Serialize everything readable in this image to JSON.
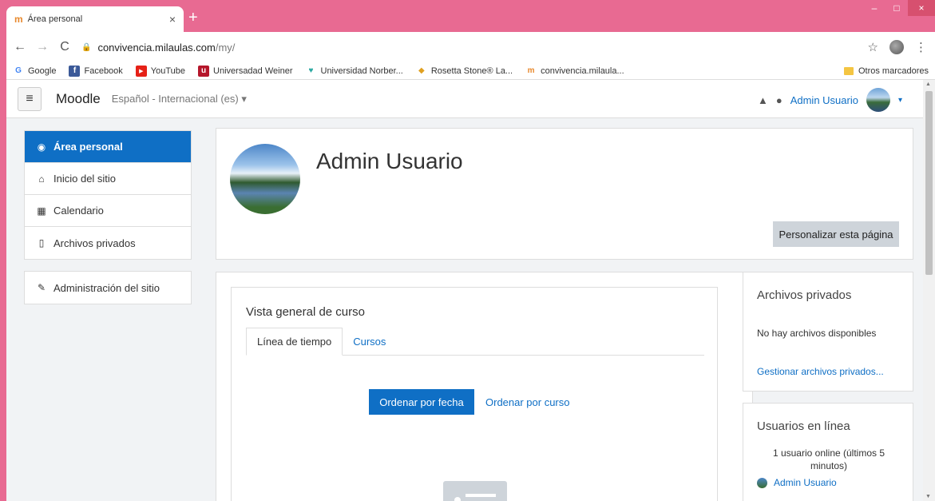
{
  "browser": {
    "tab_title": "Área personal",
    "tab_favicon": "m",
    "close_glyph": "×",
    "new_tab_glyph": "+",
    "url_host": "convivencia.milaulas.com",
    "url_path": "/my/",
    "window_controls": {
      "minimize": "–",
      "maximize": "□",
      "close": "×"
    },
    "nav_icons": {
      "back": "←",
      "forward": "→",
      "reload": "C",
      "star": "☆",
      "menu": "⋮"
    },
    "bookmarks": [
      {
        "label": "Google",
        "icon": "G",
        "color": "#4285f4"
      },
      {
        "label": "Facebook",
        "icon": "f",
        "color": "#3b5998"
      },
      {
        "label": "YouTube",
        "icon": "▶",
        "color": "#e62117"
      },
      {
        "label": "Universadad Weiner",
        "icon": "u",
        "color": "#b5162b"
      },
      {
        "label": "Universidad Norber...",
        "icon": "♥",
        "color": "#2aa8a1"
      },
      {
        "label": "Rosetta Stone® La...",
        "icon": "◆",
        "color": "#e0a020"
      },
      {
        "label": "convivencia.milaula...",
        "icon": "m",
        "color": "#e8892e"
      }
    ],
    "other_bookmarks": "Otros marcadores"
  },
  "moodle": {
    "brand": "Moodle",
    "language": "Español - Internacional (es)",
    "language_caret": "▾",
    "user_name": "Admin Usuario",
    "user_caret": "▾",
    "icons": {
      "menu": "≡",
      "bell": "🔔",
      "chat": "💬"
    }
  },
  "drawer": {
    "items": [
      {
        "label": "Área personal",
        "icon": "◉",
        "icon_name": "dashboard-icon"
      },
      {
        "label": "Inicio del sitio",
        "icon": "⌂",
        "icon_name": "home-icon"
      },
      {
        "label": "Calendario",
        "icon": "▦",
        "icon_name": "calendar-icon"
      },
      {
        "label": "Archivos privados",
        "icon": "▯",
        "icon_name": "file-icon"
      }
    ],
    "admin": {
      "label": "Administración del sitio",
      "icon": "✎",
      "icon_name": "wrench-icon"
    }
  },
  "header": {
    "title": "Admin Usuario",
    "customize_button": "Personalizar esta página"
  },
  "course_overview": {
    "title": "Vista general de curso",
    "tabs": [
      "Línea de tiempo",
      "Cursos"
    ],
    "sort_by_date": "Ordenar por fecha",
    "sort_by_course": "Ordenar por curso"
  },
  "private_files": {
    "title": "Archivos privados",
    "empty": "No hay archivos disponibles",
    "manage_link": "Gestionar archivos privados..."
  },
  "online_users": {
    "title": "Usuarios en línea",
    "summary": "1 usuario online (últimos 5 minutos)",
    "users": [
      "Admin Usuario"
    ]
  },
  "colors": {
    "accent": "#0f6fc5",
    "window_frame": "#e86a92"
  }
}
